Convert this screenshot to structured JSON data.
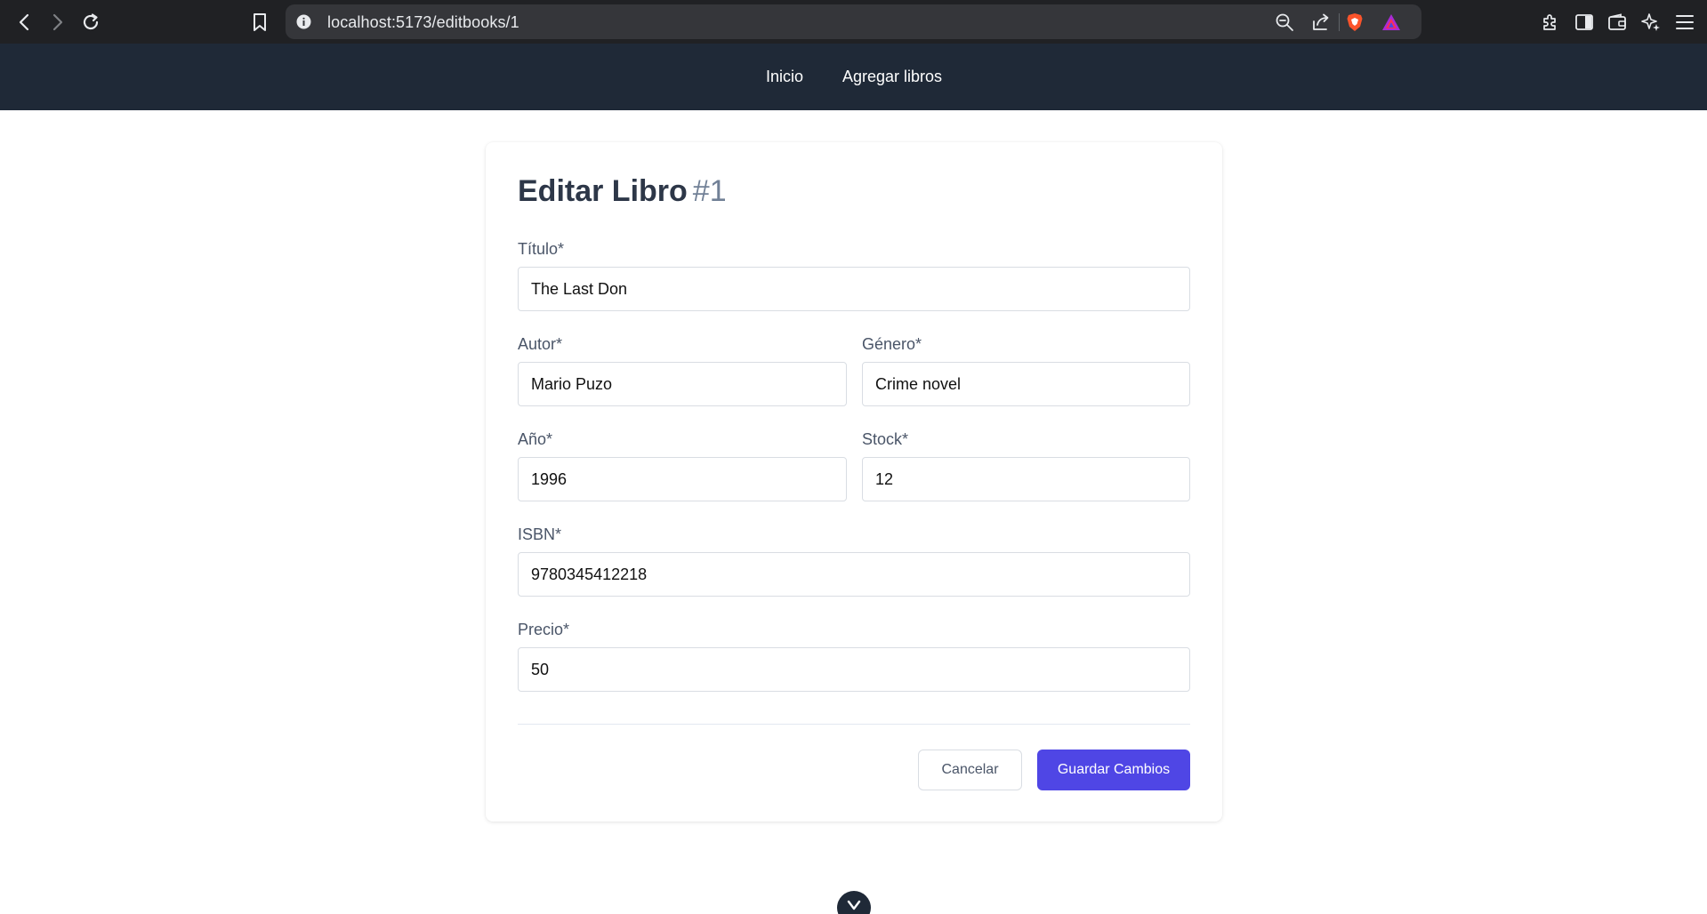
{
  "browser": {
    "url": "localhost:5173/editbooks/1",
    "icons": [
      "back-icon",
      "forward-icon",
      "reload-icon",
      "bookmark-icon",
      "site-info-icon",
      "zoom-icon",
      "share-icon",
      "brave-shields-icon",
      "brave-rewards-icon",
      "extensions-icon",
      "sidebar-icon",
      "wallet-icon",
      "leo-ai-icon",
      "menu-icon"
    ]
  },
  "nav": {
    "items": [
      {
        "label": "Inicio"
      },
      {
        "label": "Agregar libros"
      }
    ]
  },
  "form": {
    "title": "Editar Libro",
    "book_id": "#1",
    "fields": {
      "titulo": {
        "label": "Título*",
        "value": "The Last Don"
      },
      "autor": {
        "label": "Autor*",
        "value": "Mario Puzo"
      },
      "genero": {
        "label": "Género*",
        "value": "Crime novel"
      },
      "anio": {
        "label": "Año*",
        "value": "1996"
      },
      "stock": {
        "label": "Stock*",
        "value": "12"
      },
      "isbn": {
        "label": "ISBN*",
        "value": "9780345412218"
      },
      "precio": {
        "label": "Precio*",
        "value": "50"
      }
    },
    "cancel_label": "Cancelar",
    "save_label": "Guardar Cambios"
  },
  "colors": {
    "nav_bg": "#1f2937",
    "primary": "#4f46e5",
    "chrome_bg": "#202124"
  }
}
